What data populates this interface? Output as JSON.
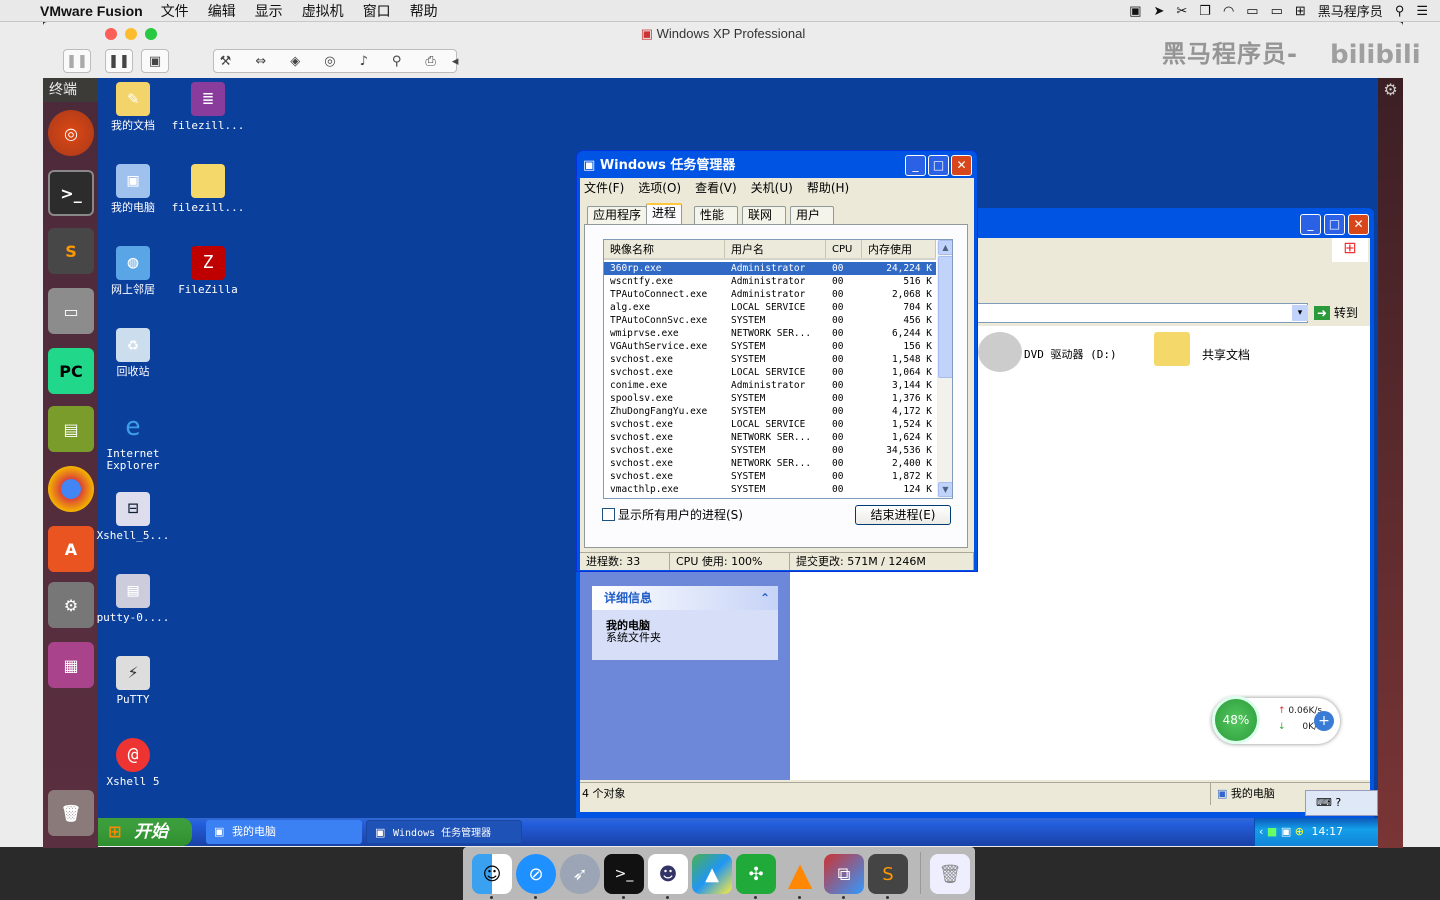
{
  "mac_menubar": {
    "app_name": "VMware Fusion",
    "menus": [
      "文件",
      "编辑",
      "显示",
      "虚拟机",
      "窗口",
      "帮助"
    ],
    "user": "黑马程序员"
  },
  "fusion": {
    "title": "Windows XP Professional",
    "watermark": "黑马程序员-"
  },
  "ubuntu": {
    "panel_title": "终端"
  },
  "desktop_icons": [
    {
      "label": "我的文档"
    },
    {
      "label": "filezill..."
    },
    {
      "label": "我的电脑"
    },
    {
      "label": "filezill..."
    },
    {
      "label": "网上邻居"
    },
    {
      "label": "FileZilla"
    },
    {
      "label": "回收站"
    },
    {
      "label": "Internet Explorer"
    },
    {
      "label": "Xshell_5..."
    },
    {
      "label": "putty-0...."
    },
    {
      "label": "PuTTY"
    },
    {
      "label": "Xshell 5"
    }
  ],
  "task_manager": {
    "title": "Windows 任务管理器",
    "menu": [
      "文件(F)",
      "选项(O)",
      "查看(V)",
      "关机(U)",
      "帮助(H)"
    ],
    "tabs": [
      "应用程序",
      "进程",
      "性能",
      "联网",
      "用户"
    ],
    "active_tab": "进程",
    "columns": [
      "映像名称",
      "用户名",
      "CPU",
      "内存使用"
    ],
    "processes": [
      [
        "360rp.exe",
        "Administrator",
        "00",
        "24,224 K"
      ],
      [
        "wscntfy.exe",
        "Administrator",
        "00",
        "516 K"
      ],
      [
        "TPAutoConnect.exe",
        "Administrator",
        "00",
        "2,068 K"
      ],
      [
        "alg.exe",
        "LOCAL SERVICE",
        "00",
        "704 K"
      ],
      [
        "TPAutoConnSvc.exe",
        "SYSTEM",
        "00",
        "456 K"
      ],
      [
        "wmiprvse.exe",
        "NETWORK SER...",
        "00",
        "6,244 K"
      ],
      [
        "VGAuthService.exe",
        "SYSTEM",
        "00",
        "156 K"
      ],
      [
        "svchost.exe",
        "SYSTEM",
        "00",
        "1,548 K"
      ],
      [
        "svchost.exe",
        "LOCAL SERVICE",
        "00",
        "1,064 K"
      ],
      [
        "conime.exe",
        "Administrator",
        "00",
        "3,144 K"
      ],
      [
        "spoolsv.exe",
        "SYSTEM",
        "00",
        "1,376 K"
      ],
      [
        "ZhuDongFangYu.exe",
        "SYSTEM",
        "00",
        "4,172 K"
      ],
      [
        "svchost.exe",
        "LOCAL SERVICE",
        "00",
        "1,524 K"
      ],
      [
        "svchost.exe",
        "NETWORK SER...",
        "00",
        "1,624 K"
      ],
      [
        "svchost.exe",
        "SYSTEM",
        "00",
        "34,536 K"
      ],
      [
        "svchost.exe",
        "NETWORK SER...",
        "00",
        "2,400 K"
      ],
      [
        "svchost.exe",
        "SYSTEM",
        "00",
        "1,872 K"
      ],
      [
        "vmacthlp.exe",
        "SYSTEM",
        "00",
        "124 K"
      ]
    ],
    "show_all_label": "显示所有用户的进程(S)",
    "end_process_label": "结束进程(E)",
    "status": {
      "procs": "进程数: 33",
      "cpu": "CPU 使用: 100%",
      "commit": "提交更改: 571M / 1246M"
    }
  },
  "explorer": {
    "go_label": "转到",
    "items": [
      "DVD 驱动器 (D:)",
      "共享文档"
    ],
    "details_header": "详细信息",
    "details_title": "我的电脑",
    "details_sub": "系统文件夹",
    "status_objects": "4 个对象",
    "status_location": "我的电脑"
  },
  "net_widget": {
    "percent": "48%",
    "up": "0.06K/s",
    "down": "0K/s"
  },
  "xp_taskbar": {
    "start": "开始",
    "items": [
      "我的电脑",
      "Windows 任务管理器"
    ],
    "clock": "14:17"
  }
}
